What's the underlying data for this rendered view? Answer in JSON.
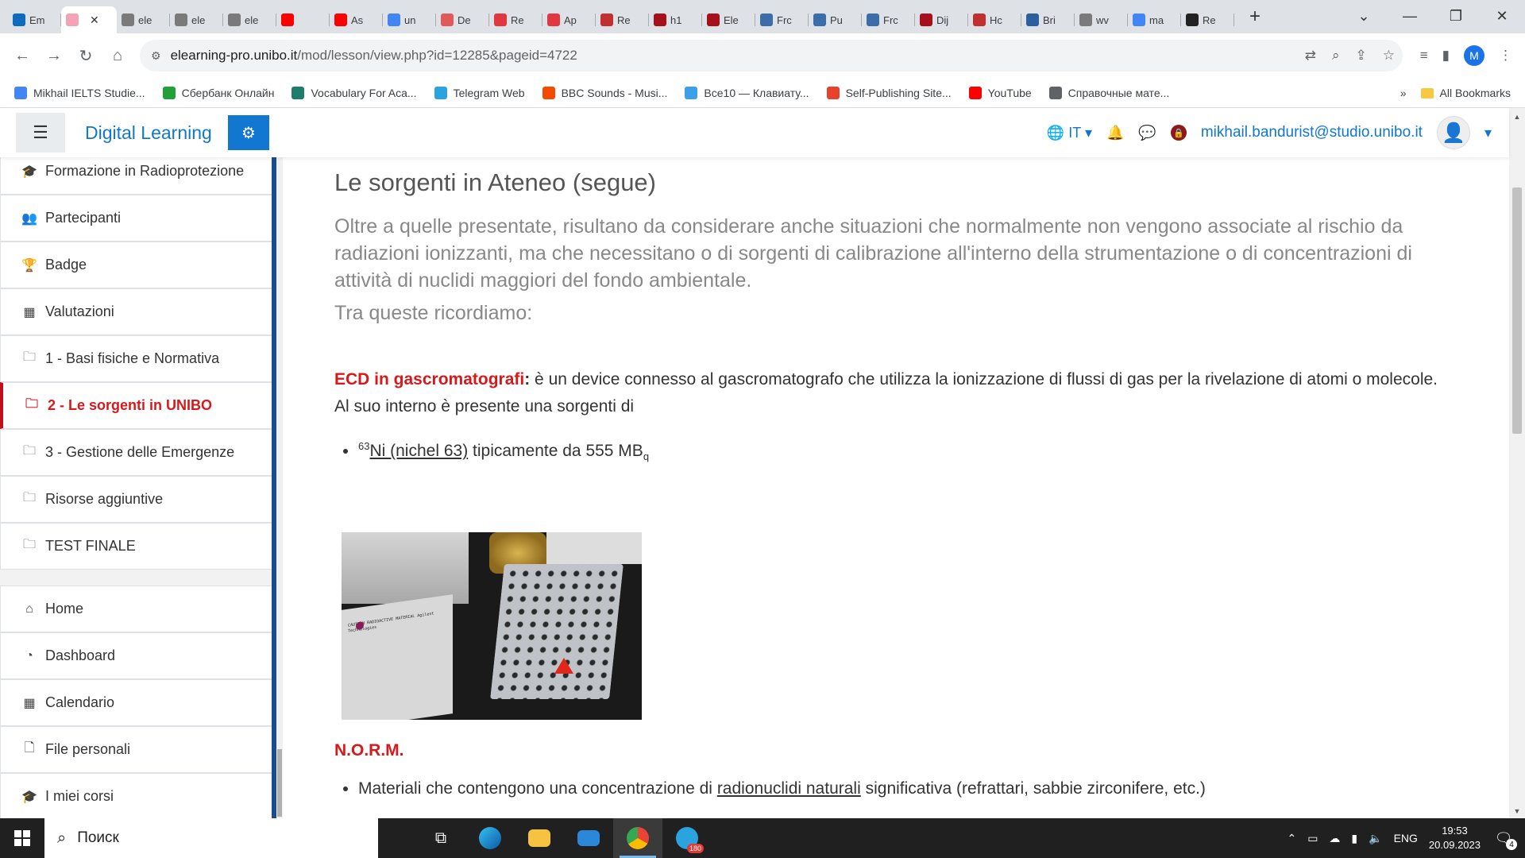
{
  "browser": {
    "tabs": [
      {
        "label": "Em",
        "color": "#0f6cbd"
      },
      {
        "label": "",
        "color": "#f3a3b5",
        "active": true
      },
      {
        "label": "ele",
        "color": "#7a7a7a"
      },
      {
        "label": "ele",
        "color": "#7a7a7a"
      },
      {
        "label": "ele",
        "color": "#7a7a7a"
      },
      {
        "label": "",
        "color": "#ff0000"
      },
      {
        "label": "As",
        "color": "#ff0000"
      },
      {
        "label": "un",
        "color": "#4285f4"
      },
      {
        "label": "De",
        "color": "#e05a5a"
      },
      {
        "label": "Re",
        "color": "#e0383e"
      },
      {
        "label": "Ap",
        "color": "#e0383e"
      },
      {
        "label": "Re",
        "color": "#c22f2f"
      },
      {
        "label": "h1",
        "color": "#a5101a"
      },
      {
        "label": "Ele",
        "color": "#a5101a"
      },
      {
        "label": "Frc",
        "color": "#3b6ea8"
      },
      {
        "label": "Pu",
        "color": "#3b6ea8"
      },
      {
        "label": "Frc",
        "color": "#3b6ea8"
      },
      {
        "label": "Dij",
        "color": "#a5101a"
      },
      {
        "label": "Hc",
        "color": "#c22f2f"
      },
      {
        "label": "Bri",
        "color": "#2c5f9e"
      },
      {
        "label": "wv",
        "color": "#7a7a7a"
      },
      {
        "label": "ma",
        "color": "#4285f4"
      },
      {
        "label": "Re",
        "color": "#222222"
      }
    ],
    "url_host": "elearning-pro.unibo.it",
    "url_path": "/mod/lesson/view.php?id=12285&pageid=4722",
    "profile_initial": "M",
    "bookmarks": [
      {
        "label": "Mikhail IELTS Studie...",
        "color": "#4285f4"
      },
      {
        "label": "Сбербанк Онлайн",
        "color": "#21a038"
      },
      {
        "label": "Vocabulary For Aca...",
        "color": "#1e7d6b"
      },
      {
        "label": "Telegram Web",
        "color": "#2aa3df"
      },
      {
        "label": "BBC Sounds - Musi...",
        "color": "#f54b00"
      },
      {
        "label": "Все10 — Клавиату...",
        "color": "#3aa0e8"
      },
      {
        "label": "Self-Publishing Site...",
        "color": "#e8412c"
      },
      {
        "label": "YouTube",
        "color": "#ff0000"
      },
      {
        "label": "Справочные мате...",
        "color": "#5f6368"
      }
    ],
    "bookmarks_overflow": "»",
    "all_bookmarks": "All Bookmarks"
  },
  "header": {
    "brand": "Digital Learning",
    "lang": "IT",
    "user_email": "mikhail.bandurist@studio.unibo.it"
  },
  "sidebar": {
    "items": [
      {
        "label": "Formazione in Radioprotezione",
        "icon": "graduation-cap-icon",
        "glyph": "🎓"
      },
      {
        "label": "Partecipanti",
        "icon": "users-icon",
        "glyph": "👥"
      },
      {
        "label": "Badge",
        "icon": "trophy-icon",
        "glyph": "🏆"
      },
      {
        "label": "Valutazioni",
        "icon": "table-icon",
        "glyph": "▦"
      },
      {
        "label": "1 - Basi fisiche e Normativa",
        "icon": "folder-icon",
        "glyph": "🗀"
      },
      {
        "label": "2 - Le sorgenti in UNIBO",
        "icon": "folder-icon",
        "glyph": "🗀",
        "active": true
      },
      {
        "label": "3 - Gestione delle Emergenze",
        "icon": "folder-icon",
        "glyph": "🗀"
      },
      {
        "label": "Risorse aggiuntive",
        "icon": "folder-icon",
        "glyph": "🗀"
      },
      {
        "label": "TEST FINALE",
        "icon": "folder-icon",
        "glyph": "🗀"
      }
    ],
    "items2": [
      {
        "label": "Home",
        "icon": "home-icon",
        "glyph": "⌂"
      },
      {
        "label": "Dashboard",
        "icon": "dashboard-icon",
        "glyph": "◔"
      },
      {
        "label": "Calendario",
        "icon": "calendar-icon",
        "glyph": "▦"
      },
      {
        "label": "File personali",
        "icon": "file-icon",
        "glyph": "🗋"
      },
      {
        "label": "I miei corsi",
        "icon": "graduation-cap-icon",
        "glyph": "🎓"
      }
    ]
  },
  "main": {
    "title": "Le sorgenti in Ateneo (segue)",
    "intro": "Oltre a quelle presentate, risultano da considerare anche situazioni che normalmente non vengono associate al rischio da radiazioni ionizzanti, ma che necessitano o di sorgenti di calibrazione all'interno della strumentazione o di concentrazioni di attività di nuclidi maggiori del fondo ambientale.",
    "intro2": "Tra queste ricordiamo:",
    "ecd_term": "ECD in gascromatografi",
    "ecd_colon": ":",
    "ecd_text": " è un device connesso al gascromatografo che utilizza la ionizzazione di flussi di gas per la rivelazione di atomi o molecole. Al suo interno è presente una sorgenti di",
    "ni_sup": "63",
    "ni_link": "Ni (nichel 63)",
    "ni_text": " tipicamente da 555 MB",
    "ni_sub": "q",
    "norm_title": "N.O.R.M.",
    "norm_text_pre": "Materiali che contengono una concentrazione di ",
    "norm_link": "radionuclidi naturali",
    "norm_text_post": " significativa (refrattari, sabbie zirconifere, etc.)",
    "photo_label_text": "CAUTION RADIOACTIVE MATERIAL Agilent Technologies"
  },
  "taskbar": {
    "search_placeholder": "Поиск",
    "telegram_badge": "180",
    "lang": "ENG",
    "time": "19:53",
    "date": "20.09.2023",
    "notifications": "4"
  }
}
